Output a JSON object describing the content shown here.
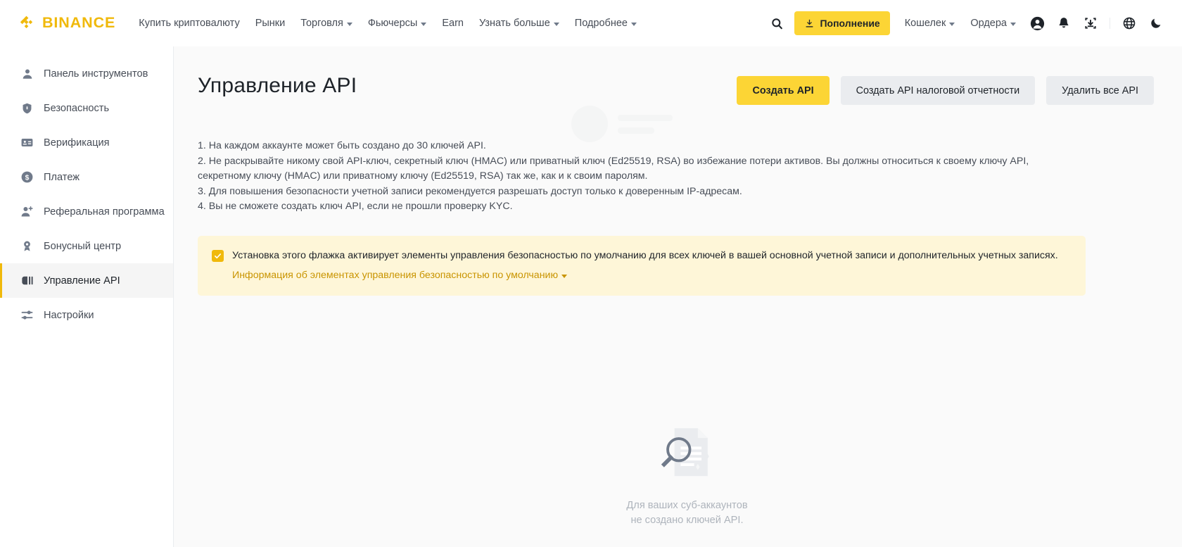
{
  "brand": {
    "name": "BINANCE",
    "color": "#F0B90B"
  },
  "topnav": {
    "links": [
      {
        "label": "Купить криптовалюту",
        "has_caret": false
      },
      {
        "label": "Рынки",
        "has_caret": false
      },
      {
        "label": "Торговля",
        "has_caret": true
      },
      {
        "label": "Фьючерсы",
        "has_caret": true
      },
      {
        "label": "Earn",
        "has_caret": false
      },
      {
        "label": "Узнать больше",
        "has_caret": true
      },
      {
        "label": "Подробнее",
        "has_caret": true
      }
    ],
    "search_icon": "search-icon",
    "deposit_button": "Пополнение",
    "right_links": [
      {
        "label": "Кошелек",
        "has_caret": true
      },
      {
        "label": "Ордера",
        "has_caret": true
      }
    ],
    "icons": [
      "profile-icon",
      "notification-bell-icon",
      "download-app-icon",
      "language-globe-icon",
      "dark-mode-moon-icon"
    ]
  },
  "sidebar": {
    "items": [
      {
        "label": "Панель инструментов",
        "icon": "dashboard-user-icon",
        "active": false
      },
      {
        "label": "Безопасность",
        "icon": "shield-lock-icon",
        "active": false
      },
      {
        "label": "Верификация",
        "icon": "id-card-icon",
        "active": false
      },
      {
        "label": "Платеж",
        "icon": "dollar-circle-icon",
        "active": false
      },
      {
        "label": "Реферальная программа",
        "icon": "user-plus-icon",
        "active": false
      },
      {
        "label": "Бонусный центр",
        "icon": "award-medal-icon",
        "active": false
      },
      {
        "label": "Управление API",
        "icon": "api-plug-icon",
        "active": true
      },
      {
        "label": "Настройки",
        "icon": "sliders-settings-icon",
        "active": false
      }
    ]
  },
  "main": {
    "title": "Управление API",
    "actions": {
      "create_api": "Создать API",
      "create_tax_api": "Создать API налоговой отчетности",
      "delete_all_api": "Удалить все API"
    },
    "info_lines": [
      "1. На каждом аккаунте может быть создано до 30 ключей API.",
      "2. Не раскрывайте никому свой API-ключ, секретный ключ (HMAC) или приватный ключ (Ed25519, RSA) во избежание потери активов. Вы должны относиться к своему ключу API, секретному ключу (HMAC) или приватному ключу (Ed25519, RSA) так же, как и к своим паролям.",
      "3. Для повышения безопасности учетной записи рекомендуется разрешать доступ только к доверенным IP-адресам.",
      "4. Вы не сможете создать ключ API, если не прошли проверку KYC."
    ],
    "alert": {
      "checked": true,
      "check_glyph": "✓",
      "text": "Установка этого флажка активирует элементы управления безопасностью по умолчанию для всех ключей в вашей основной учетной записи и дополнительных учетных записях.",
      "link": "Информация об элементах управления безопасностью по умолчанию",
      "bg_color": "#FEF6D8",
      "link_color": "#C99400"
    },
    "empty_state": {
      "icon": "document-search-icon",
      "line1": "Для ваших суб-аккаунтов",
      "line2": "не создано ключей API."
    }
  }
}
